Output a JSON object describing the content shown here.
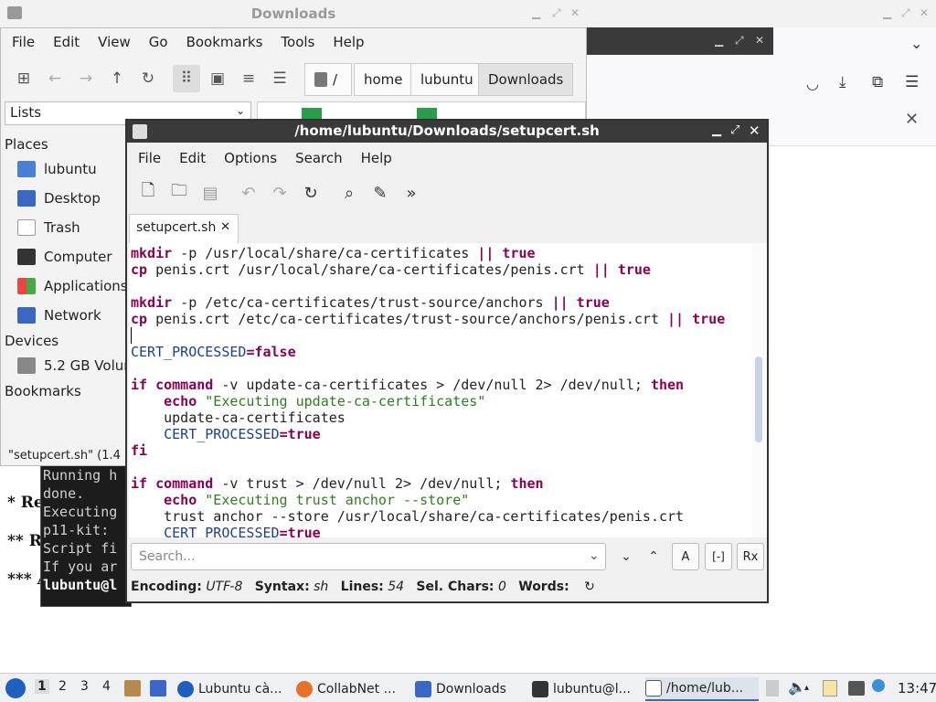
{
  "desktop": {
    "title": "Downloads"
  },
  "file_manager": {
    "title": "Downloads",
    "menu": [
      "File",
      "Edit",
      "View",
      "Go",
      "Bookmarks",
      "Tools",
      "Help"
    ],
    "path": {
      "root": "/",
      "crumbs": [
        "home",
        "lubuntu",
        "Downloads"
      ]
    },
    "side_mode": "Lists",
    "sections": {
      "places": "Places",
      "devices": "Devices",
      "bookmarks": "Bookmarks"
    },
    "places": [
      "lubuntu",
      "Desktop",
      "Trash",
      "Computer",
      "Applications",
      "Network"
    ],
    "devices": [
      "5.2 GB Volum"
    ],
    "status": "\"setupcert.sh\" (1.4"
  },
  "terminal": {
    "lines": [
      "Running h",
      "done.",
      "Executing",
      "p11-kit:",
      "Script fi",
      "If you ar",
      "lubuntu@l"
    ]
  },
  "page_behind": {
    "items": [
      "* Re",
      "** R",
      "*** A"
    ]
  },
  "editor": {
    "title": "/home/lubuntu/Downloads/setupcert.sh",
    "menu": [
      "File",
      "Edit",
      "Options",
      "Search",
      "Help"
    ],
    "tab": "setupcert.sh",
    "search_placeholder": "Search...",
    "status": {
      "encoding_label": "Encoding:",
      "encoding": "UTF-8",
      "syntax_label": "Syntax:",
      "syntax": "sh",
      "lines_label": "Lines:",
      "lines": "54",
      "sel_label": "Sel. Chars:",
      "sel": "0",
      "words_label": "Words:"
    },
    "code": {
      "l1a": "mkdir",
      "l1b": " -p /usr/local/share/ca-certificates ",
      "l1c": "|| ",
      "l1d": "true",
      "l2a": "cp",
      "l2b": " penis.crt /usr/local/share/ca-certificates/penis.crt ",
      "l2c": "|| ",
      "l2d": "true",
      "l3a": "mkdir",
      "l3b": " -p /etc/ca-certificates/trust-source/anchors ",
      "l3c": "|| ",
      "l3d": "true",
      "l4a": "cp",
      "l4b": " penis.crt /etc/ca-certificates/trust-source/anchors/penis.crt ",
      "l4c": "|| ",
      "l4d": "true",
      "l5a": "CERT_PROCESSED",
      "l5b": "=",
      "l5c": "false",
      "l6a": "if",
      "l6b": " command",
      "l6c": " -v update-ca-certificates ",
      "l6d": "> /dev/null 2> /dev/null; ",
      "l6e": "then",
      "l7a": "    echo",
      "l7b": " \"Executing update-ca-certificates\"",
      "l8": "    update-ca-certificates",
      "l9a": "    CERT_PROCESSED",
      "l9b": "=",
      "l9c": "true",
      "l10": "fi",
      "l11a": "if",
      "l11b": " command",
      "l11c": " -v trust ",
      "l11d": "> /dev/null 2> /dev/null; ",
      "l11e": "then",
      "l12a": "    echo",
      "l12b": " \"Executing trust anchor --store\"",
      "l13": "    trust anchor --store /usr/local/share/ca-certificates/penis.crt",
      "l14a": "    CERT_PROCESSED",
      "l14b": "=",
      "l14c": "true"
    }
  },
  "taskbar": {
    "workspaces": [
      "1",
      "2",
      "3",
      "4"
    ],
    "tasks": [
      "Lubuntu cà...",
      "CollabNet ...",
      "Downloads",
      "lubuntu@l...",
      "/home/lub..."
    ],
    "clock": "13:47"
  }
}
